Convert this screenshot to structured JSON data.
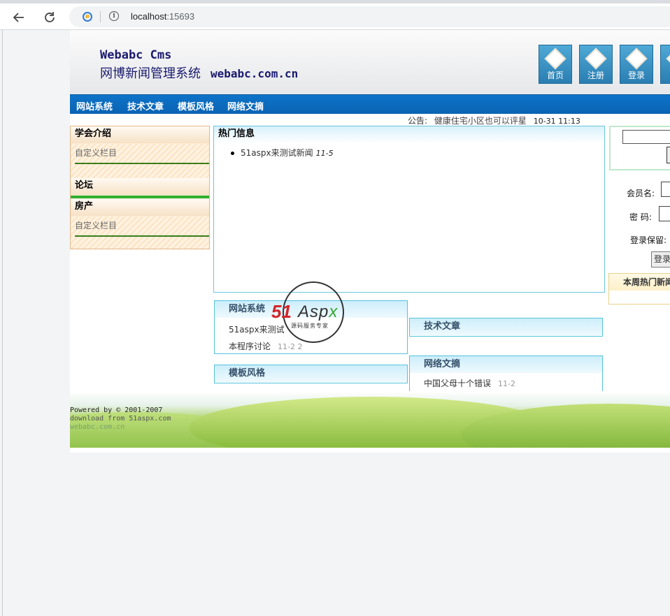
{
  "browser": {
    "back_icon": "arrow-left-icon",
    "reload_icon": "reload-icon",
    "site_icon": "ie-icon",
    "info_icon": "info-icon",
    "url_host": "localhost",
    "url_port": ":15693"
  },
  "header": {
    "logo_line1": "Webabc Cms",
    "logo_line2": "网博新闻管理系统",
    "logo_url": "webabc.com.cn",
    "buttons": [
      {
        "label": "首页"
      },
      {
        "label": "注册"
      },
      {
        "label": "登录"
      }
    ]
  },
  "nav": {
    "items": [
      "网站系统",
      "技术文章",
      "模板风格",
      "网络文摘"
    ]
  },
  "notice": {
    "label": "公告:",
    "text": "健康住宅小区也可以评星",
    "time": "10-31 11:13"
  },
  "left": {
    "sections": [
      {
        "title": "学会介绍",
        "item": "自定义栏目"
      },
      {
        "title": "论坛"
      },
      {
        "title": "房产",
        "item": "自定义栏目"
      }
    ]
  },
  "hot": {
    "title": "热门信息",
    "items": [
      {
        "text": "51aspx来测试新闻",
        "date": "11-5"
      }
    ]
  },
  "categories": {
    "web_system": {
      "title": "网站系统",
      "items": [
        {
          "text": "51aspx来测试",
          "date": ""
        },
        {
          "text": "本程序讨论",
          "date": "11-2 2"
        }
      ]
    },
    "tech": {
      "title": "技术文章"
    },
    "template": {
      "title": "模板风格"
    },
    "digest": {
      "title": "网络文摘",
      "items": [
        {
          "text": "中国父母十个错误",
          "date": "11-2"
        }
      ]
    }
  },
  "watermark": {
    "brand_51": "51",
    "brand_aspx": "Aspx",
    "tagline": "源码服务专家"
  },
  "right": {
    "member_label": "会员名:",
    "password_label": "密 码:",
    "remember_label": "登录保留:",
    "login_button": "登录",
    "weekly_title": "本周热门新闻"
  },
  "footer": {
    "line1": "Powered by © 2001-2007",
    "line2": "download from 51aspx.com",
    "line3": "webabc.com.cn"
  }
}
